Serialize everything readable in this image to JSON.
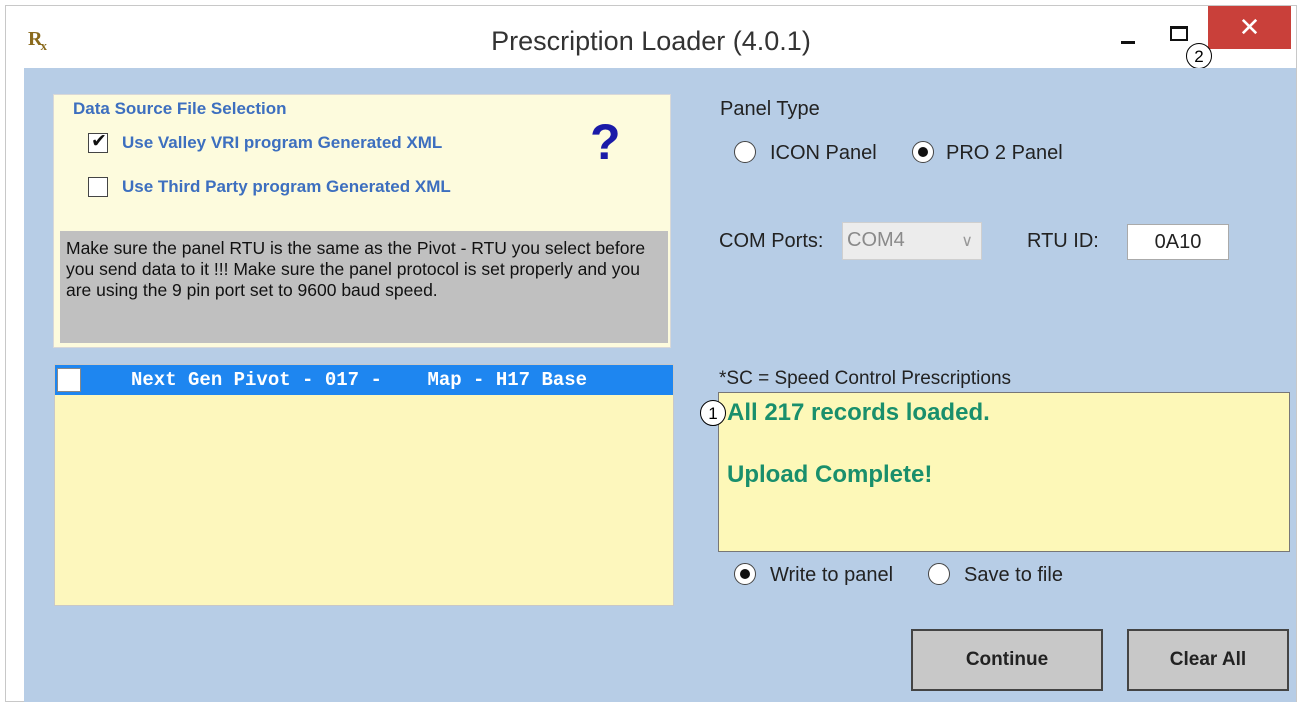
{
  "window": {
    "app_icon_text": "R",
    "app_icon_sub": "x",
    "title": "Prescription Loader (4.0.1)",
    "close_glyph": "✕",
    "callout_close": "2"
  },
  "data_source": {
    "legend": "Data Source File Selection",
    "option_valley": {
      "label": "Use Valley VRI program  Generated XML",
      "checked": true
    },
    "option_third_party": {
      "label": "Use Third Party program  Generated XML",
      "checked": false
    },
    "help_glyph": "?",
    "warning": "Make sure the panel RTU is the same as the Pivot - RTU you select before you send data to it !!! Make sure the panel protocol is set properly and you are using the 9 pin port set to 9600 baud speed."
  },
  "prescription_list": {
    "items": [
      {
        "text": "Next Gen Pivot - 017 -    Map - H17 Base",
        "checked": false,
        "selected": true
      }
    ]
  },
  "panel_type": {
    "label": "Panel Type",
    "options": [
      "ICON Panel",
      "PRO 2 Panel"
    ],
    "selected": "PRO 2 Panel"
  },
  "com": {
    "label": "COM Ports:",
    "value": "COM4",
    "rtu_label": "RTU ID:",
    "rtu_value": "0A10"
  },
  "status": {
    "caption": "*SC = Speed Control Prescriptions",
    "line1": "All 217 records loaded.",
    "line2": "Upload Complete!",
    "callout": "1",
    "text_color": "#198f6c"
  },
  "output": {
    "options": [
      "Write to panel",
      "Save to file"
    ],
    "selected": "Write to panel"
  },
  "buttons": {
    "continue": "Continue",
    "clear_all": "Clear All"
  },
  "colors": {
    "client_bg": "#b7cde6",
    "close_button": "#c9403a",
    "list_selection": "#1e86f0"
  }
}
